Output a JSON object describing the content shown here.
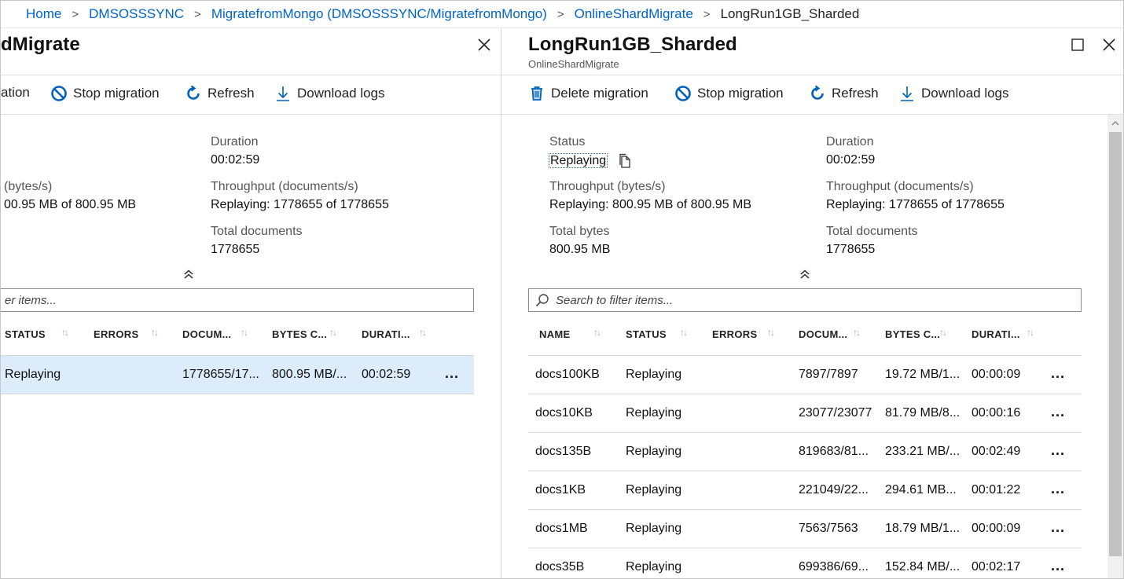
{
  "breadcrumb": {
    "items": [
      "Home",
      "DMSOSSSYNC",
      "MigratefromMongo (DMSOSSSYNC/MigratefromMongo)",
      "OnlineShardMigrate"
    ],
    "current": "LongRun1GB_Sharded",
    "separator": ">"
  },
  "left_blade": {
    "title": "dMigrate",
    "toolbar": {
      "partial_label": "ation",
      "stop": "Stop migration",
      "refresh": "Refresh",
      "download": "Download logs"
    },
    "props": {
      "duration_label": "Duration",
      "duration_value": "00:02:59",
      "throughput_bytes_label": "(bytes/s)",
      "throughput_bytes_value": "00.95 MB of 800.95 MB",
      "throughput_docs_label": "Throughput (documents/s)",
      "throughput_docs_value": "Replaying: 1778655 of 1778655",
      "total_docs_label": "Total documents",
      "total_docs_value": "1778655"
    },
    "search_placeholder": "er items...",
    "columns": [
      "STATUS",
      "ERRORS",
      "DOCUM...",
      "BYTES C...",
      "DURATI..."
    ],
    "rows": [
      {
        "status": "Replaying",
        "errors": "",
        "documents": "1778655/17...",
        "bytes": "800.95 MB/...",
        "duration": "00:02:59"
      }
    ]
  },
  "right_blade": {
    "title": "LongRun1GB_Sharded",
    "subtitle": "OnlineShardMigrate",
    "toolbar": {
      "delete": "Delete migration",
      "stop": "Stop migration",
      "refresh": "Refresh",
      "download": "Download logs"
    },
    "props": {
      "status_label": "Status",
      "status_value": "Replaying",
      "duration_label": "Duration",
      "duration_value": "00:02:59",
      "throughput_bytes_label": "Throughput (bytes/s)",
      "throughput_bytes_value": "Replaying: 800.95 MB of 800.95 MB",
      "throughput_docs_label": "Throughput (documents/s)",
      "throughput_docs_value": "Replaying: 1778655 of 1778655",
      "total_bytes_label": "Total bytes",
      "total_bytes_value": "800.95 MB",
      "total_docs_label": "Total documents",
      "total_docs_value": "1778655"
    },
    "search_placeholder": "Search to filter items...",
    "columns": [
      "NAME",
      "STATUS",
      "ERRORS",
      "DOCUM...",
      "BYTES C...",
      "DURATI..."
    ],
    "rows": [
      {
        "name": "docs100KB",
        "status": "Replaying",
        "errors": "",
        "documents": "7897/7897",
        "bytes": "19.72 MB/1...",
        "duration": "00:00:09"
      },
      {
        "name": "docs10KB",
        "status": "Replaying",
        "errors": "",
        "documents": "23077/23077",
        "bytes": "81.79 MB/8...",
        "duration": "00:00:16"
      },
      {
        "name": "docs135B",
        "status": "Replaying",
        "errors": "",
        "documents": "819683/81...",
        "bytes": "233.21 MB/...",
        "duration": "00:02:49"
      },
      {
        "name": "docs1KB",
        "status": "Replaying",
        "errors": "",
        "documents": "221049/22...",
        "bytes": "294.61 MB...",
        "duration": "00:01:22"
      },
      {
        "name": "docs1MB",
        "status": "Replaying",
        "errors": "",
        "documents": "7563/7563",
        "bytes": "18.79 MB/1...",
        "duration": "00:00:09"
      },
      {
        "name": "docs35B",
        "status": "Replaying",
        "errors": "",
        "documents": "699386/69...",
        "bytes": "152.84 MB/...",
        "duration": "00:02:17"
      }
    ],
    "more_label": "..."
  },
  "icons": {
    "close": "close-icon",
    "maximize": "maximize-icon",
    "stop": "stop-circle-icon",
    "refresh": "refresh-icon",
    "download": "download-icon",
    "delete": "trash-icon",
    "copy": "copy-icon",
    "collapse": "double-chevron-up-icon",
    "search": "search-icon",
    "sort": "sort-arrows-icon"
  },
  "colors": {
    "link": "#0064c8",
    "accent": "#0078d4",
    "selected_row": "#dcecfb"
  }
}
